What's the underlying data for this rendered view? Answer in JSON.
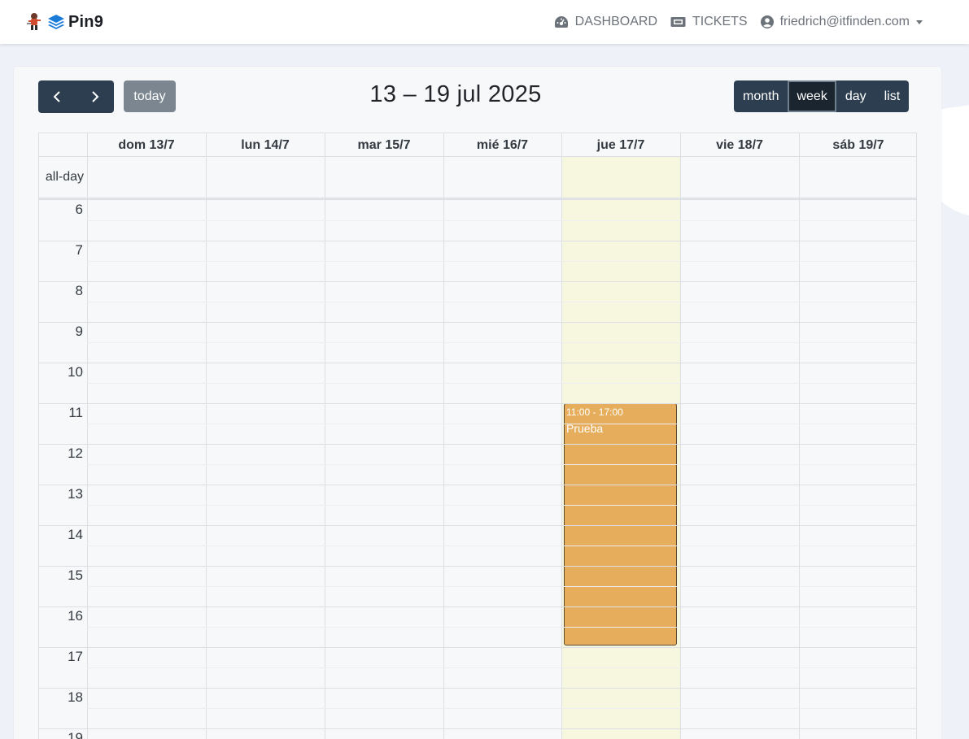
{
  "navbar": {
    "brand": "Pin9",
    "links": [
      {
        "label": "DASHBOARD",
        "icon": "dashboard-gauge-icon"
      },
      {
        "label": "TICKETS",
        "icon": "ticket-icon"
      }
    ],
    "user": {
      "email": "friedrich@itfinden.com",
      "icon": "user-circle-icon"
    }
  },
  "toolbar": {
    "prev_icon": "chevron-left-icon",
    "next_icon": "chevron-right-icon",
    "today_label": "today",
    "title": "13 – 19 jul 2025",
    "views": [
      "month",
      "week",
      "day",
      "list"
    ],
    "active_view": "week"
  },
  "calendar": {
    "allday_label": "all-day",
    "days": [
      "dom 13/7",
      "lun 14/7",
      "mar 15/7",
      "mié 16/7",
      "jue 17/7",
      "vie 18/7",
      "sáb 19/7"
    ],
    "today_index": 4,
    "hours": [
      "6",
      "7",
      "8",
      "9",
      "10",
      "11",
      "12",
      "13",
      "14",
      "15",
      "16",
      "17",
      "18",
      "19"
    ],
    "events": [
      {
        "day_index": 4,
        "time": "11:00 - 17:00",
        "title": "Prueba",
        "color": "#e6ae5c"
      }
    ]
  },
  "colors": {
    "primary_dark": "#2c3e50",
    "today_highlight": "#f7f6df",
    "event": "#e6ae5c",
    "today_button": "#7b8690"
  }
}
